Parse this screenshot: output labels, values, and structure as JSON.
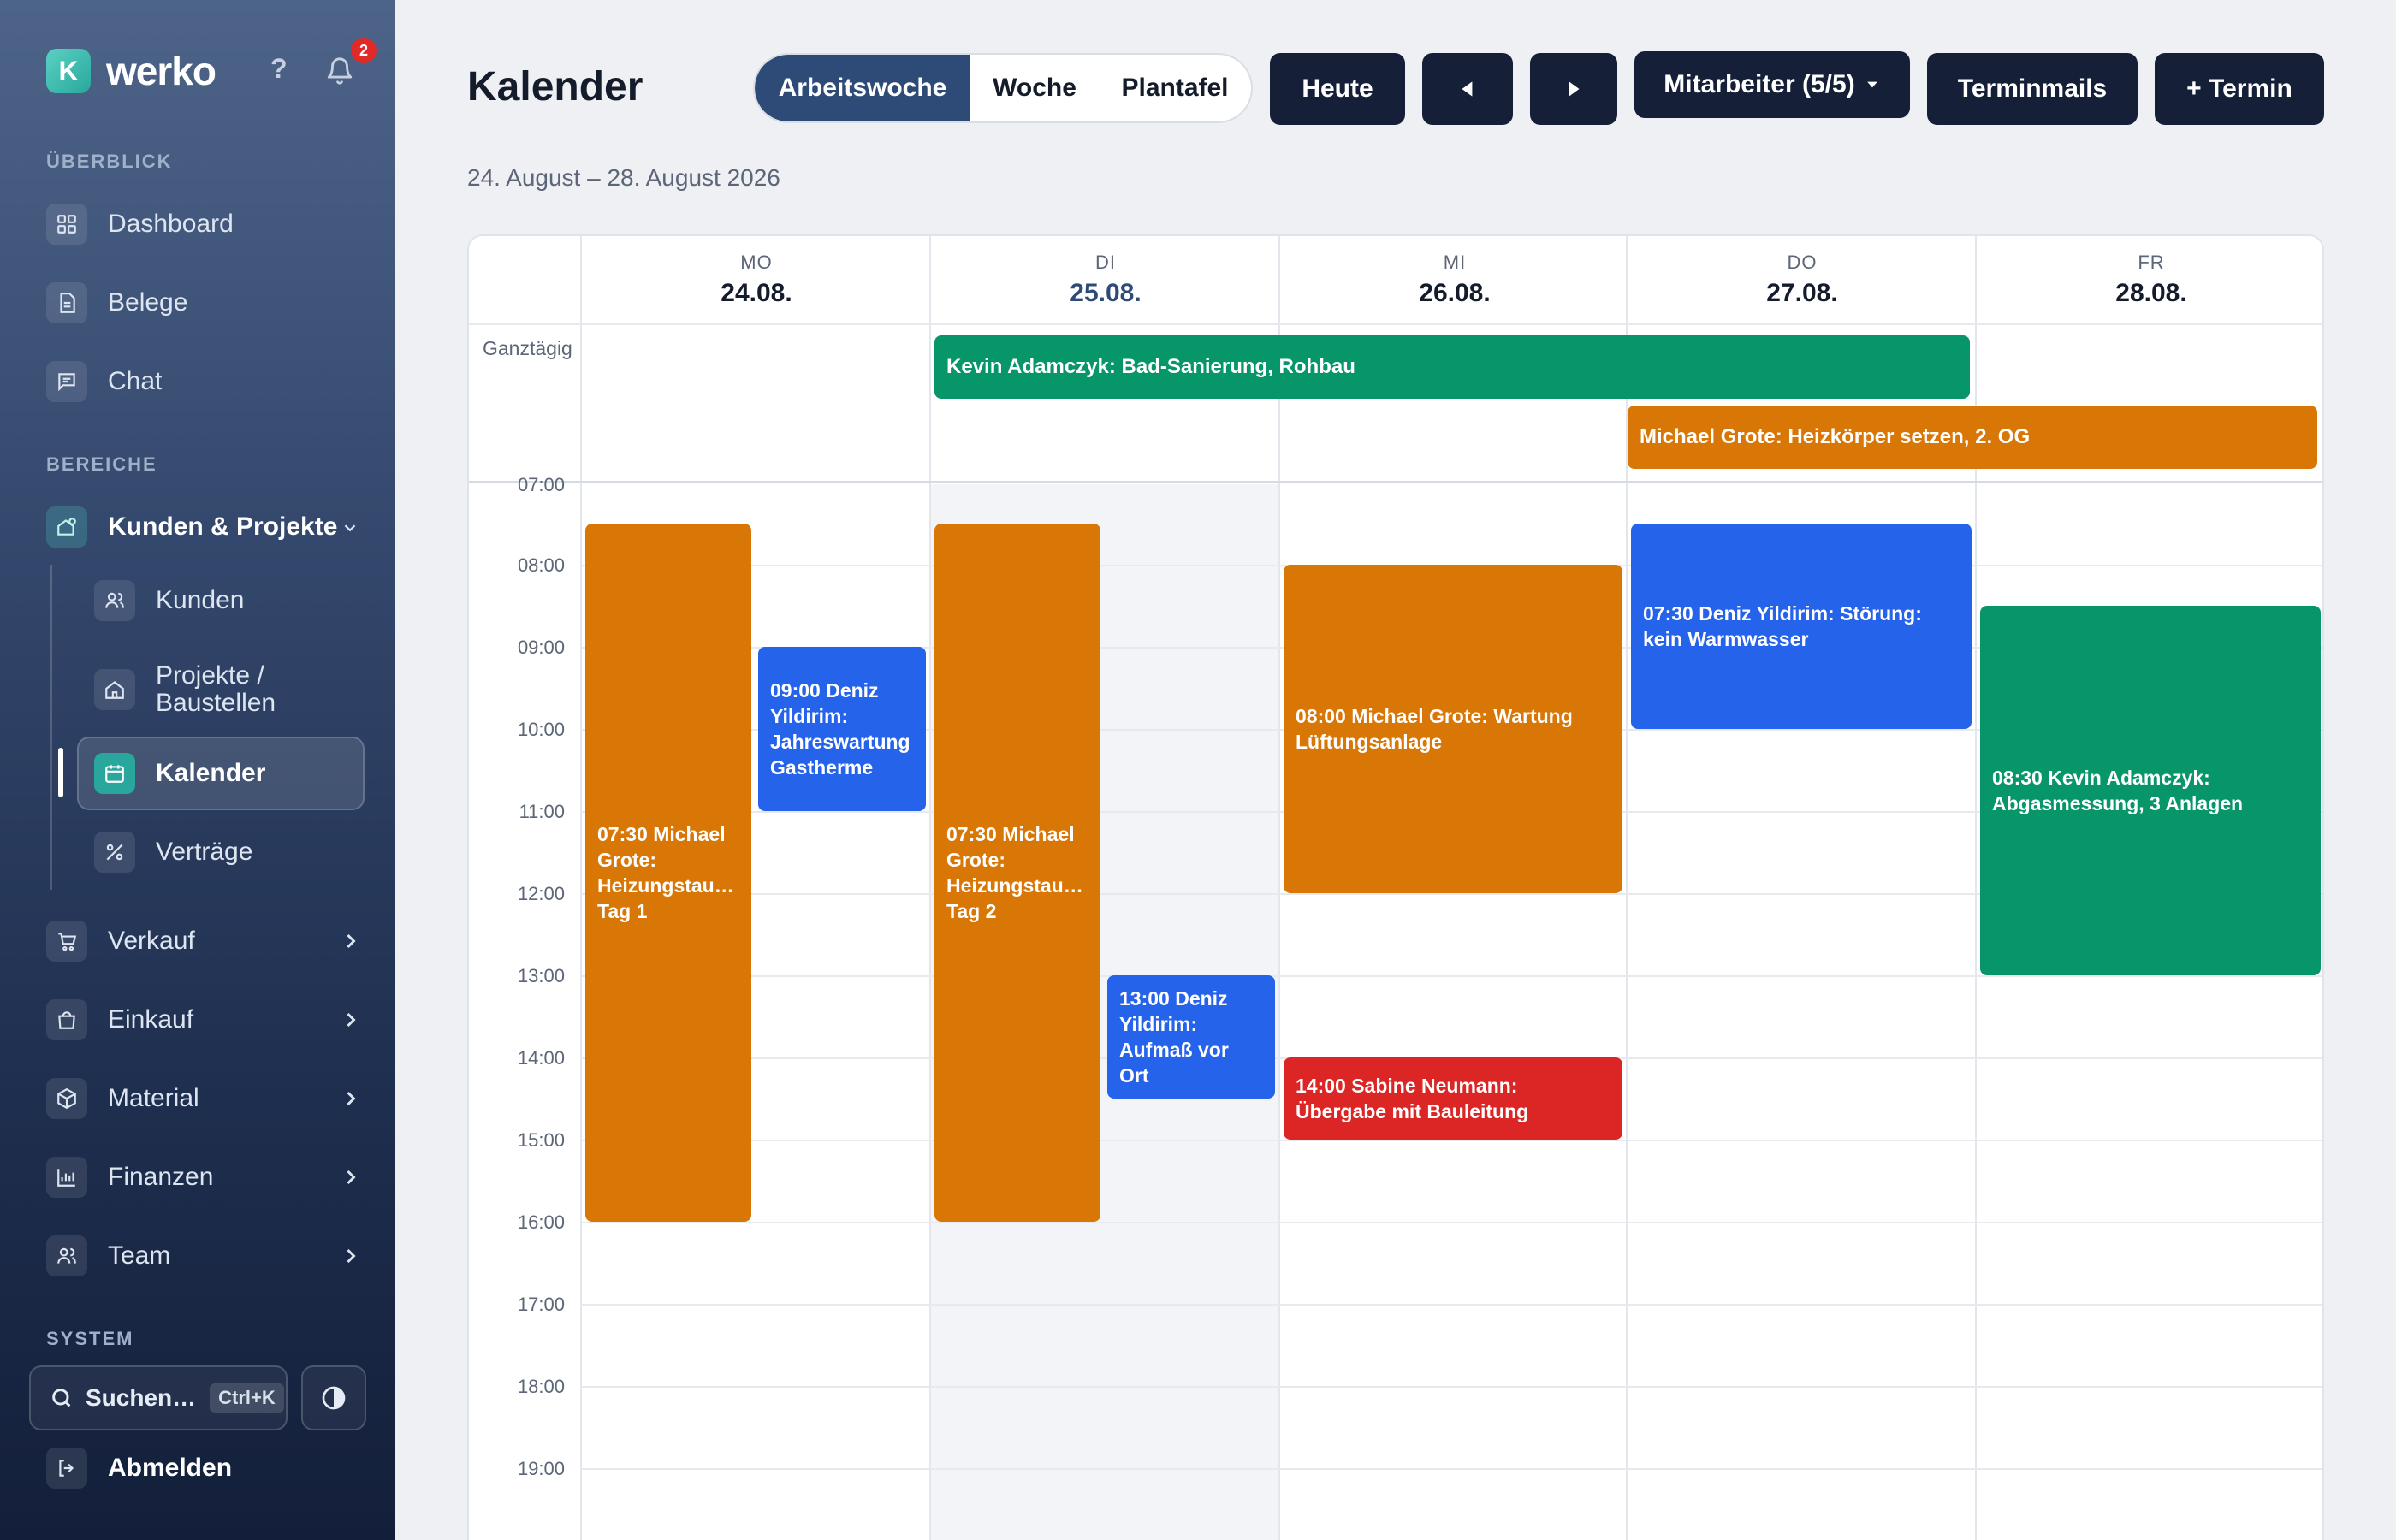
{
  "app": {
    "logo_letter": "K",
    "name": "werko",
    "help": "?",
    "notification_count": "2"
  },
  "sidebar": {
    "section_overview": "ÜBERBLICK",
    "section_areas": "BEREICHE",
    "section_system": "SYSTEM",
    "overview_items": [
      {
        "label": "Dashboard",
        "icon": "grid-icon"
      },
      {
        "label": "Belege",
        "icon": "document-icon"
      },
      {
        "label": "Chat",
        "icon": "chat-icon"
      }
    ],
    "group": {
      "label": "Kunden & Projekte",
      "icon": "projects-icon",
      "expanded": true
    },
    "sub_items": [
      {
        "label": "Kunden",
        "icon": "users-icon"
      },
      {
        "label_line1": "Projekte /",
        "label_line2": "Baustellen",
        "icon": "home-icon"
      },
      {
        "label": "Kalender",
        "icon": "calendar-icon",
        "active": true
      },
      {
        "label": "Verträge",
        "icon": "contract-icon"
      }
    ],
    "area_items": [
      {
        "label": "Verkauf",
        "icon": "cart-icon"
      },
      {
        "label": "Einkauf",
        "icon": "bag-icon"
      },
      {
        "label": "Material",
        "icon": "box-icon"
      },
      {
        "label": "Finanzen",
        "icon": "chart-icon"
      },
      {
        "label": "Team",
        "icon": "team-icon"
      }
    ],
    "search": {
      "label": "Suchen…",
      "shortcut": "Ctrl+K"
    },
    "logout": "Abmelden"
  },
  "header": {
    "title": "Kalender",
    "date_range": "24. August – 28. August 2026",
    "views": [
      {
        "label": "Arbeitswoche",
        "active": true
      },
      {
        "label": "Woche",
        "active": false
      },
      {
        "label": "Plantafel",
        "active": false
      }
    ],
    "today": "Heute",
    "staff_filter": "Mitarbeiter (5/5)",
    "term_mails": "Terminmails",
    "new_event": "+ Termin"
  },
  "calendar": {
    "allday_label": "Ganztägig",
    "days": [
      {
        "name": "MO",
        "date": "24.08.",
        "today": false
      },
      {
        "name": "DI",
        "date": "25.08.",
        "today": true
      },
      {
        "name": "MI",
        "date": "26.08.",
        "today": false
      },
      {
        "name": "DO",
        "date": "27.08.",
        "today": false
      },
      {
        "name": "FR",
        "date": "28.08.",
        "today": false
      }
    ],
    "hours": [
      "07:00",
      "08:00",
      "09:00",
      "10:00",
      "11:00",
      "12:00",
      "13:00",
      "14:00",
      "15:00",
      "16:00",
      "17:00",
      "18:00",
      "19:00"
    ],
    "allday_events": [
      {
        "title": "Kevin Adamczyk: Bad-Sanierung, Rohbau",
        "color": "#079669",
        "start_day": "DI",
        "end_day": "DO"
      },
      {
        "title": "Michael Grote: Heizkörper setzen, 2. OG",
        "color": "#d97706",
        "start_day": "DO",
        "end_day": "FR"
      }
    ],
    "events": [
      {
        "day": "MO",
        "start": "07:30",
        "end": "16:00",
        "lines": [
          "07:30 Michael",
          "Grote:",
          "Heizungstau…",
          "Tag 1"
        ],
        "color": "#d97706"
      },
      {
        "day": "MO",
        "start": "09:00",
        "end": "11:00",
        "lines": [
          "09:00 Deniz",
          "Yildirim:",
          "Jahreswartung",
          "Gastherme"
        ],
        "color": "#2563eb"
      },
      {
        "day": "DI",
        "start": "07:30",
        "end": "16:00",
        "lines": [
          "07:30 Michael",
          "Grote:",
          "Heizungstau…",
          "Tag 2"
        ],
        "color": "#d97706"
      },
      {
        "day": "DI",
        "start": "13:00",
        "end": "14:30",
        "lines": [
          "13:00 Deniz",
          "Yildirim:",
          "Aufmaß vor",
          "Ort"
        ],
        "color": "#2563eb"
      },
      {
        "day": "MI",
        "start": "08:00",
        "end": "12:00",
        "lines": [
          "08:00 Michael Grote: Wartung",
          "Lüftungsanlage"
        ],
        "color": "#d97706"
      },
      {
        "day": "MI",
        "start": "14:00",
        "end": "15:00",
        "lines": [
          "14:00 Sabine Neumann:",
          "Übergabe mit Bauleitung"
        ],
        "color": "#dc2626"
      },
      {
        "day": "DO",
        "start": "07:30",
        "end": "10:00",
        "lines": [
          "07:30 Deniz Yildirim: Störung:",
          "kein Warmwasser"
        ],
        "color": "#2563eb"
      },
      {
        "day": "FR",
        "start": "08:30",
        "end": "13:00",
        "lines": [
          "08:30 Kevin Adamczyk:",
          "Abgasmessung, 3 Anlagen"
        ],
        "color": "#079669"
      }
    ]
  }
}
